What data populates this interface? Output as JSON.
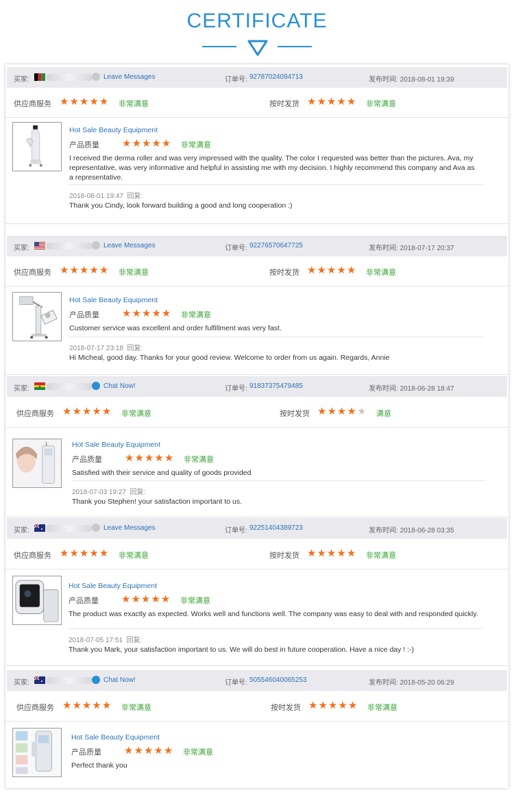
{
  "header": {
    "title": "CERTIFICATE"
  },
  "labels": {
    "buyer": "买家:",
    "order": "订单号:",
    "published": "发布时间:",
    "supplier_service": "供应商服务",
    "on_time": "按时发货",
    "quality": "产品质量",
    "reply": "回复:"
  },
  "colors": {
    "accent": "#2a8fd3",
    "star": "#f0711d",
    "satisfied": "#3aa336"
  },
  "reviews": [
    {
      "flag": "afghanistan",
      "action": "Leave Messages",
      "order_no": "92787024094713",
      "published": "2018-08-01 19:39",
      "supplier_stars": 5,
      "supplier_text": "非常满意",
      "ontime_stars": 5,
      "ontime_text": "非常满意",
      "product": "Hot Sale Beauty Equipment",
      "quality_stars": 5,
      "quality_text": "非常满意",
      "comment": "I received the derma roller and was very impressed with the quality. The color I requested was better than the pictures. Ava, my representative, was very informative and helpful in assisting me with my decision. I highly recommend this company and Ava as a representative.",
      "reply_time": "2018-08-01 19:47",
      "reply": "Thank you Cindy, look forward building a good and long cooperation :)"
    },
    {
      "flag": "usa",
      "action": "Leave Messages",
      "order_no": "92276570647725",
      "published": "2018-07-17 20:37",
      "supplier_stars": 5,
      "supplier_text": "非常满意",
      "ontime_stars": 5,
      "ontime_text": "非常满意",
      "product": "Hot Sale Beauty Equipment",
      "quality_stars": 5,
      "quality_text": "非常满意",
      "comment": "Customer service was excellent and order fulfillment was very fast.",
      "reply_time": "2018-07-17 23:18",
      "reply": "Hi Micheal, good day. Thanks for your good review. Welcome to order from us again. Regards, Annie"
    },
    {
      "flag": "ghana",
      "action": "Chat Now!",
      "order_no": "91837375479485",
      "published": "2018-06-28 18:47",
      "supplier_stars": 5,
      "supplier_text": "非常满意",
      "ontime_stars": 4,
      "ontime_text": "满意",
      "product": "Hot Sale Beauty Equipment",
      "quality_stars": 5,
      "quality_text": "非常满意",
      "comment": "Satisfied with their service and quality of goods provided",
      "reply_time": "2018-07-03 19:27",
      "reply": "Thank you Stephen! your satisfaction important to us."
    },
    {
      "flag": "australia",
      "action": "Leave Messages",
      "order_no": "92251404389723",
      "published": "2018-06-28 03:35",
      "supplier_stars": 5,
      "supplier_text": "非常满意",
      "ontime_stars": 5,
      "ontime_text": "非常满意",
      "product": "Hot Sale Beauty Equipment",
      "quality_stars": 5,
      "quality_text": "非常满意",
      "comment": "The product was exactly as expected. Works well and functions well. The company was easy to deal with and responded quickly.",
      "reply_time": "2018-07-05 17:51",
      "reply": "Thank you Mark, your satisfaction important to us. We will do best in future cooperation. Have a nice day ! :-)"
    },
    {
      "flag": "australia",
      "action": "Chat Now!",
      "order_no": "505546040065253",
      "published": "2018-05-20 06:29",
      "supplier_stars": 5,
      "supplier_text": "非常满意",
      "ontime_stars": 5,
      "ontime_text": "非常满意",
      "product": "Hot Sale Beauty Equipment",
      "quality_stars": 5,
      "quality_text": "非常满意",
      "comment": "Perfect thank you",
      "reply_time": "",
      "reply": ""
    }
  ]
}
